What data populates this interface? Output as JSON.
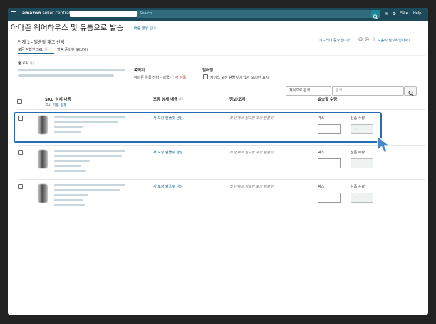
{
  "topbar": {
    "brand": "amazon",
    "brand_sub": "seller central",
    "search_placeholder": "Search",
    "lang": "EN ▾",
    "help": "Help"
  },
  "page": {
    "title": "아마존 웨어하우스 및 유통으로 발송",
    "title_link": "배송 생성 안내"
  },
  "step": {
    "label": "단계 1 - 발송할 재고 선택",
    "feedback": "피드백이 중요합니다.",
    "help_link": "도움이 필요하십니까?"
  },
  "tabs": {
    "all_label": "모든 적합한 SKU",
    "ready_label": "발송 준비된 SKU(0)"
  },
  "sections": {
    "source_label": "출고지",
    "destination_label": "목적지",
    "destination_text": "아마존 유통 센터 - 미국",
    "destination_new": "새 상품",
    "filter_label": "필터링",
    "filter_option": "케이스 포장 템플릿이 있는 SKU만 표시"
  },
  "controls": {
    "sort_label": "제목으로 검색",
    "search_placeholder": "검색"
  },
  "table": {
    "col_sku": "SKU 상세 내용",
    "col_sku_sub": "표시 기본 설정",
    "col_pack": "포장 상세 내용",
    "col_info": "정보/조치",
    "col_qty": "발송할 수량"
  },
  "rows": [
    {
      "pack_link": "새 포장 템플릿 생성",
      "info": "첫 번째로 필요한 포장 템플릿",
      "box_label": "박스",
      "qty_label": "상품 수량",
      "qty_value": "-"
    },
    {
      "pack_link": "새 포장 템플릿 생성",
      "info": "첫 번째로 필요한 포장 템플릿",
      "box_label": "박스",
      "qty_label": "상품 수량",
      "qty_value": "-"
    },
    {
      "pack_link": "새 포장 템플릿 생성",
      "info": "첫 번째로 필요한 포장 템플릿",
      "box_label": "박스",
      "qty_label": "상품 수량",
      "qty_value": "-"
    }
  ],
  "colors": {
    "topbar": "#1d4a5a",
    "link": "#1f6b8a",
    "highlight": "#2a6bb6",
    "destructive": "#c0392b"
  }
}
